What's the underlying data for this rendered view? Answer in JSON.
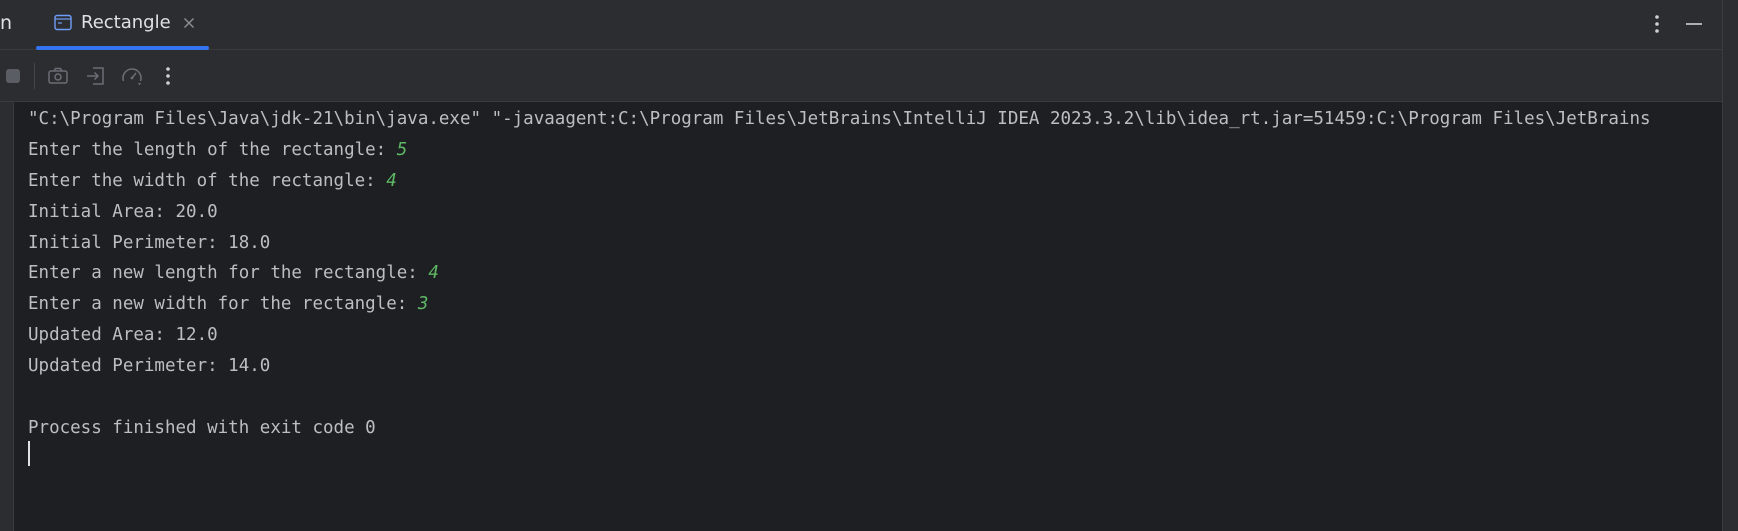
{
  "tabbar": {
    "partial_label": "n",
    "active_tab": {
      "label": "Rectangle"
    }
  },
  "console": {
    "lines": [
      {
        "text": "\"C:\\Program Files\\Java\\jdk-21\\bin\\java.exe\" \"-javaagent:C:\\Program Files\\JetBrains\\IntelliJ IDEA 2023.3.2\\lib\\idea_rt.jar=51459:C:\\Program Files\\JetBrains",
        "input": ""
      },
      {
        "text": "Enter the length of the rectangle: ",
        "input": "5"
      },
      {
        "text": "Enter the width of the rectangle: ",
        "input": "4"
      },
      {
        "text": "Initial Area: 20.0",
        "input": ""
      },
      {
        "text": "Initial Perimeter: 18.0",
        "input": ""
      },
      {
        "text": "Enter a new length for the rectangle: ",
        "input": "4"
      },
      {
        "text": "Enter a new width for the rectangle: ",
        "input": "3"
      },
      {
        "text": "Updated Area: 12.0",
        "input": ""
      },
      {
        "text": "Updated Perimeter: 14.0",
        "input": ""
      },
      {
        "text": "",
        "input": ""
      },
      {
        "text": "Process finished with exit code 0",
        "input": ""
      }
    ]
  },
  "icons": {
    "tab": "console-window-icon",
    "tab_close": "close-icon",
    "more": "vertical-dots-icon",
    "minimize": "minimize-icon",
    "toolbar": [
      "stop-icon",
      "camera-icon",
      "import-icon",
      "speedometer-icon",
      "vertical-dots-icon"
    ]
  },
  "colors": {
    "accent": "#3574f0",
    "user_input": "#5fb865",
    "text": "#bcbec4",
    "background": "#1e1f22",
    "panel": "#2b2d30"
  }
}
